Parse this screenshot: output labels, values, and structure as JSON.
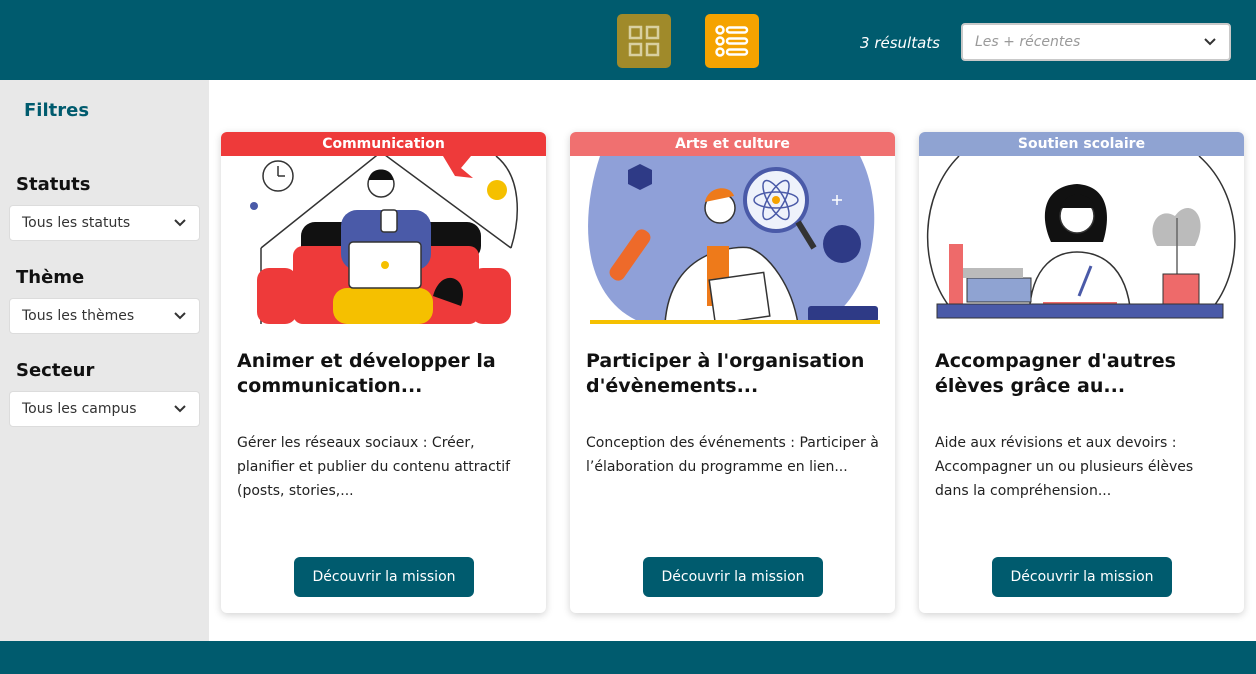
{
  "header": {
    "results_text": "3 résultats",
    "sort": {
      "placeholder": "Les + récentes"
    },
    "view_grid_icon": "grid-icon",
    "view_list_icon": "list-icon",
    "colors": {
      "bar": "#005b6e",
      "grid_button": "#a08a2a",
      "list_button": "#f5a300"
    }
  },
  "sidebar": {
    "title": "Filtres",
    "filters": [
      {
        "label": "Statuts",
        "value": "Tous les statuts"
      },
      {
        "label": "Thème",
        "value": "Tous les thèmes"
      },
      {
        "label": "Secteur",
        "value": "Tous les campus"
      }
    ]
  },
  "cards": [
    {
      "badge": "Communication",
      "badge_color": "#ee3a3a",
      "title": "Animer et développer la communication...",
      "description": "Gérer les réseaux sociaux : Créer, planifier et publier du contenu attractif (posts, stories,...",
      "button": "Découvrir la mission"
    },
    {
      "badge": "Arts et culture",
      "badge_color": "#f07070",
      "title": "Participer à l'organisation d'évènements...",
      "description": "Conception des événements : Participer à l’élaboration du programme en lien...",
      "button": "Découvrir la mission"
    },
    {
      "badge": "Soutien scolaire",
      "badge_color": "#8fa3d2",
      "title": "Accompagner d'autres élèves grâce au...",
      "description": "Aide aux révisions et aux devoirs : Accompagner un ou plusieurs élèves dans la compréhension...",
      "button": "Découvrir la mission"
    }
  ]
}
